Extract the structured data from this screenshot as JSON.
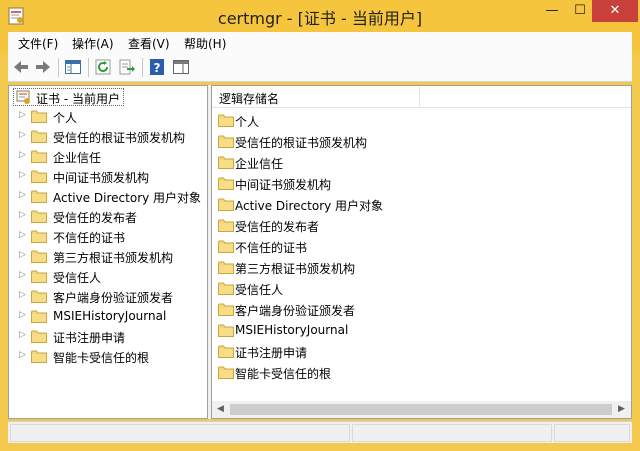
{
  "window": {
    "title": "certmgr - [证书 - 当前用户]",
    "minimize_glyph": "—",
    "maximize_glyph": "☐",
    "close_glyph": "✕",
    "frame_color": "#f5c53d"
  },
  "menu": {
    "items": [
      "文件(F)",
      "操作(A)",
      "查看(V)",
      "帮助(H)"
    ]
  },
  "toolbar": {
    "icons": [
      "back-arrow-icon",
      "forward-arrow-icon",
      "show-hide-console-tree-icon",
      "refresh-icon",
      "export-list-icon",
      "help-icon",
      "show-action-pane-icon"
    ]
  },
  "tree": {
    "root_label": "证书 - 当前用户",
    "items": [
      {
        "label": "个人"
      },
      {
        "label": "受信任的根证书颁发机构"
      },
      {
        "label": "企业信任"
      },
      {
        "label": "中间证书颁发机构"
      },
      {
        "label": "Active Directory 用户对象"
      },
      {
        "label": "受信任的发布者"
      },
      {
        "label": "不信任的证书"
      },
      {
        "label": "第三方根证书颁发机构"
      },
      {
        "label": "受信任人"
      },
      {
        "label": "客户端身份验证颁发者"
      },
      {
        "label": "MSIEHistoryJournal"
      },
      {
        "label": "证书注册申请"
      },
      {
        "label": "智能卡受信任的根"
      }
    ]
  },
  "list": {
    "column_header": "逻辑存储名",
    "items": [
      {
        "label": "个人"
      },
      {
        "label": "受信任的根证书颁发机构"
      },
      {
        "label": "企业信任"
      },
      {
        "label": "中间证书颁发机构"
      },
      {
        "label": "Active Directory 用户对象"
      },
      {
        "label": "受信任的发布者"
      },
      {
        "label": "不信任的证书"
      },
      {
        "label": "第三方根证书颁发机构"
      },
      {
        "label": "受信任人"
      },
      {
        "label": "客户端身份验证颁发者"
      },
      {
        "label": "MSIEHistoryJournal"
      },
      {
        "label": "证书注册申请"
      },
      {
        "label": "智能卡受信任的根"
      }
    ]
  },
  "scrollbar": {
    "left_glyph": "◀",
    "right_glyph": "▶"
  }
}
